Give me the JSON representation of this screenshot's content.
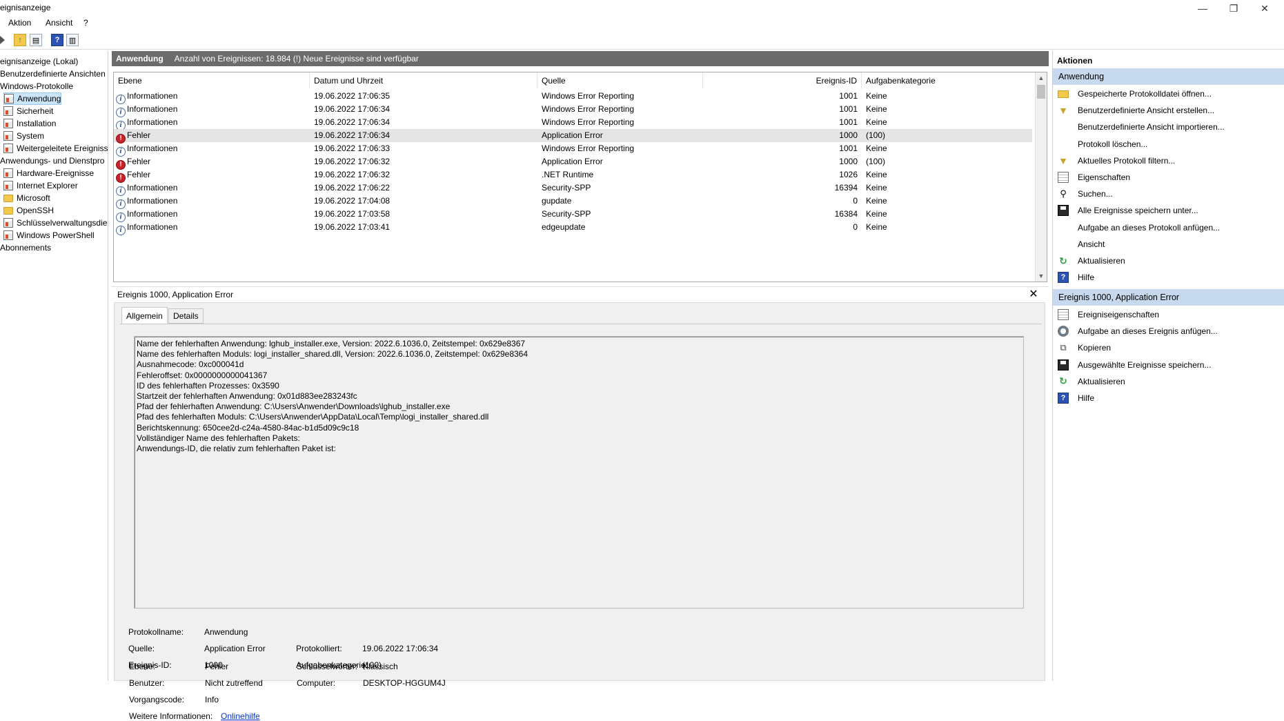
{
  "window": {
    "title": "Ereignisanzeige",
    "title_visible": "eignisanzeige",
    "controls": {
      "minimize": "—",
      "restore": "❐",
      "close": "✕"
    }
  },
  "menu": {
    "items": [
      "Aktion",
      "Ansicht",
      "?"
    ]
  },
  "toolbar": {
    "icons": [
      "back-icon",
      "up-folder-icon",
      "show-hide-tree-icon",
      "help-icon",
      "show-hide-action-pane-icon"
    ]
  },
  "tree": {
    "items": [
      {
        "label": "Ereignisanzeige (Lokal)",
        "visible": "eignisanzeige (Lokal)",
        "indent": 0,
        "icon": "none"
      },
      {
        "label": "Benutzerdefinierte Ansichten",
        "visible": "Benutzerdefinierte Ansichten",
        "indent": 0,
        "icon": "none"
      },
      {
        "label": "Windows-Protokolle",
        "visible": "Windows-Protokolle",
        "indent": 0,
        "icon": "none"
      },
      {
        "label": "Anwendung",
        "visible": "Anwendung",
        "indent": 1,
        "icon": "log-icon",
        "selected": true
      },
      {
        "label": "Sicherheit",
        "visible": "Sicherheit",
        "indent": 1,
        "icon": "log-icon"
      },
      {
        "label": "Installation",
        "visible": "Installation",
        "indent": 1,
        "icon": "log-icon"
      },
      {
        "label": "System",
        "visible": "System",
        "indent": 1,
        "icon": "log-icon"
      },
      {
        "label": "Weitergeleitete Ereignisse",
        "visible": "Weitergeleitete Ereignisse",
        "indent": 1,
        "icon": "log-icon"
      },
      {
        "label": "Anwendungs- und Dienstprotokolle",
        "visible": "Anwendungs- und Dienstpro",
        "indent": 0,
        "icon": "none"
      },
      {
        "label": "Hardware-Ereignisse",
        "visible": "Hardware-Ereignisse",
        "indent": 1,
        "icon": "log-icon"
      },
      {
        "label": "Internet Explorer",
        "visible": "Internet Explorer",
        "indent": 1,
        "icon": "log-icon"
      },
      {
        "label": "Microsoft",
        "visible": "Microsoft",
        "indent": 1,
        "icon": "folder-icon"
      },
      {
        "label": "OpenSSH",
        "visible": "OpenSSH",
        "indent": 1,
        "icon": "folder-icon"
      },
      {
        "label": "Schlüsselverwaltungsdienst",
        "visible": "Schlüsselverwaltungsdien",
        "indent": 1,
        "icon": "log-icon"
      },
      {
        "label": "Windows PowerShell",
        "visible": "Windows PowerShell",
        "indent": 1,
        "icon": "log-icon"
      },
      {
        "label": "Abonnements",
        "visible": "Abonnements",
        "indent": 0,
        "icon": "none"
      }
    ]
  },
  "list": {
    "header_title": "Anwendung",
    "header_info": "Anzahl von Ereignissen: 18.984 (!) Neue Ereignisse sind verfügbar",
    "columns": [
      "Ebene",
      "Datum und Uhrzeit",
      "Quelle",
      "Ereignis-ID",
      "Aufgabenkategorie"
    ],
    "rows": [
      {
        "level": "Informationen",
        "type": "info",
        "date": "19.06.2022 17:06:35",
        "source": "Windows Error Reporting",
        "id": "1001",
        "category": "Keine"
      },
      {
        "level": "Informationen",
        "type": "info",
        "date": "19.06.2022 17:06:34",
        "source": "Windows Error Reporting",
        "id": "1001",
        "category": "Keine"
      },
      {
        "level": "Informationen",
        "type": "info",
        "date": "19.06.2022 17:06:34",
        "source": "Windows Error Reporting",
        "id": "1001",
        "category": "Keine"
      },
      {
        "level": "Fehler",
        "type": "error",
        "date": "19.06.2022 17:06:34",
        "source": "Application Error",
        "id": "1000",
        "category": "(100)",
        "selected": true
      },
      {
        "level": "Informationen",
        "type": "info",
        "date": "19.06.2022 17:06:33",
        "source": "Windows Error Reporting",
        "id": "1001",
        "category": "Keine"
      },
      {
        "level": "Fehler",
        "type": "error",
        "date": "19.06.2022 17:06:32",
        "source": "Application Error",
        "id": "1000",
        "category": "(100)"
      },
      {
        "level": "Fehler",
        "type": "error",
        "date": "19.06.2022 17:06:32",
        "source": ".NET Runtime",
        "id": "1026",
        "category": "Keine"
      },
      {
        "level": "Informationen",
        "type": "info",
        "date": "19.06.2022 17:06:22",
        "source": "Security-SPP",
        "id": "16394",
        "category": "Keine"
      },
      {
        "level": "Informationen",
        "type": "info",
        "date": "19.06.2022 17:04:08",
        "source": "gupdate",
        "id": "0",
        "category": "Keine"
      },
      {
        "level": "Informationen",
        "type": "info",
        "date": "19.06.2022 17:03:58",
        "source": "Security-SPP",
        "id": "16384",
        "category": "Keine"
      },
      {
        "level": "Informationen",
        "type": "info",
        "date": "19.06.2022 17:03:41",
        "source": "edgeupdate",
        "id": "0",
        "category": "Keine"
      }
    ]
  },
  "detail": {
    "title": "Ereignis 1000, Application Error",
    "tabs": [
      "Allgemein",
      "Details"
    ],
    "description": [
      "Name der fehlerhaften Anwendung: lghub_installer.exe, Version: 2022.6.1036.0, Zeitstempel: 0x629e8367",
      "Name des fehlerhaften Moduls: logi_installer_shared.dll, Version: 2022.6.1036.0, Zeitstempel: 0x629e8364",
      "Ausnahmecode: 0xc000041d",
      "Fehleroffset: 0x0000000000041367",
      "ID des fehlerhaften Prozesses: 0x3590",
      "Startzeit der fehlerhaften Anwendung: 0x01d883ee283243fc",
      "Pfad der fehlerhaften Anwendung: C:\\Users\\Anwender\\Downloads\\lghub_installer.exe",
      "Pfad des fehlerhaften Moduls: C:\\Users\\Anwender\\AppData\\Local\\Temp\\logi_installer_shared.dll",
      "Berichtskennung: 650cee2d-c24a-4580-84ac-b1d5d09c9c18",
      "Vollständiger Name des fehlerhaften Pakets:",
      "Anwendungs-ID, die relativ zum fehlerhaften Paket ist:"
    ],
    "props": {
      "protokollname_label": "Protokollname:",
      "protokollname": "Anwendung",
      "quelle_label": "Quelle:",
      "quelle": "Application Error",
      "protokolliert_label": "Protokolliert:",
      "protokolliert": "19.06.2022 17:06:34",
      "id_label": "Ereignis-ID:",
      "id": "1000",
      "aufgabe_label": "Aufgabenkategorie:",
      "aufgabe": "(100)",
      "ebene_label": "Ebene:",
      "ebene": "Fehler",
      "schluessel_label": "Schlüsselwörter:",
      "schluessel": "Klassisch",
      "benutzer_label": "Benutzer:",
      "benutzer": "Nicht zutreffend",
      "computer_label": "Computer:",
      "computer": "DESKTOP-HGGUM4J",
      "vorgang_label": "Vorgangscode:",
      "vorgang": "Info",
      "weitere_label": "Weitere Informationen:",
      "weitere_link": "Onlinehilfe"
    }
  },
  "actions": {
    "title": "Aktionen",
    "section1": "Anwendung",
    "items1": [
      {
        "label": "Gespeicherte Protokolldatei öffnen...",
        "icon": "open-icon"
      },
      {
        "label": "Benutzerdefinierte Ansicht erstellen...",
        "icon": "filter-icon"
      },
      {
        "label": "Benutzerdefinierte Ansicht importieren...",
        "icon": "none"
      },
      {
        "label": "Protokoll löschen...",
        "icon": "none"
      },
      {
        "label": "Aktuelles Protokoll filtern...",
        "icon": "filter-icon"
      },
      {
        "label": "Eigenschaften",
        "icon": "properties-icon"
      },
      {
        "label": "Suchen...",
        "icon": "find-icon"
      },
      {
        "label": "Alle Ereignisse speichern unter...",
        "icon": "save-icon"
      },
      {
        "label": "Aufgabe an dieses Protokoll anfügen...",
        "icon": "none"
      },
      {
        "label": "Ansicht",
        "icon": "none"
      },
      {
        "label": "Aktualisieren",
        "icon": "refresh-icon"
      },
      {
        "label": "Hilfe",
        "icon": "help-icon"
      }
    ],
    "section2": "Ereignis 1000, Application Error",
    "items2": [
      {
        "label": "Ereigniseigenschaften",
        "icon": "properties-icon"
      },
      {
        "label": "Aufgabe an dieses Ereignis anfügen...",
        "icon": "task-icon"
      },
      {
        "label": "Kopieren",
        "icon": "copy-icon"
      },
      {
        "label": "Ausgewählte Ereignisse speichern...",
        "icon": "save-icon"
      },
      {
        "label": "Aktualisieren",
        "icon": "refresh-icon"
      },
      {
        "label": "Hilfe",
        "icon": "help-icon"
      }
    ]
  }
}
